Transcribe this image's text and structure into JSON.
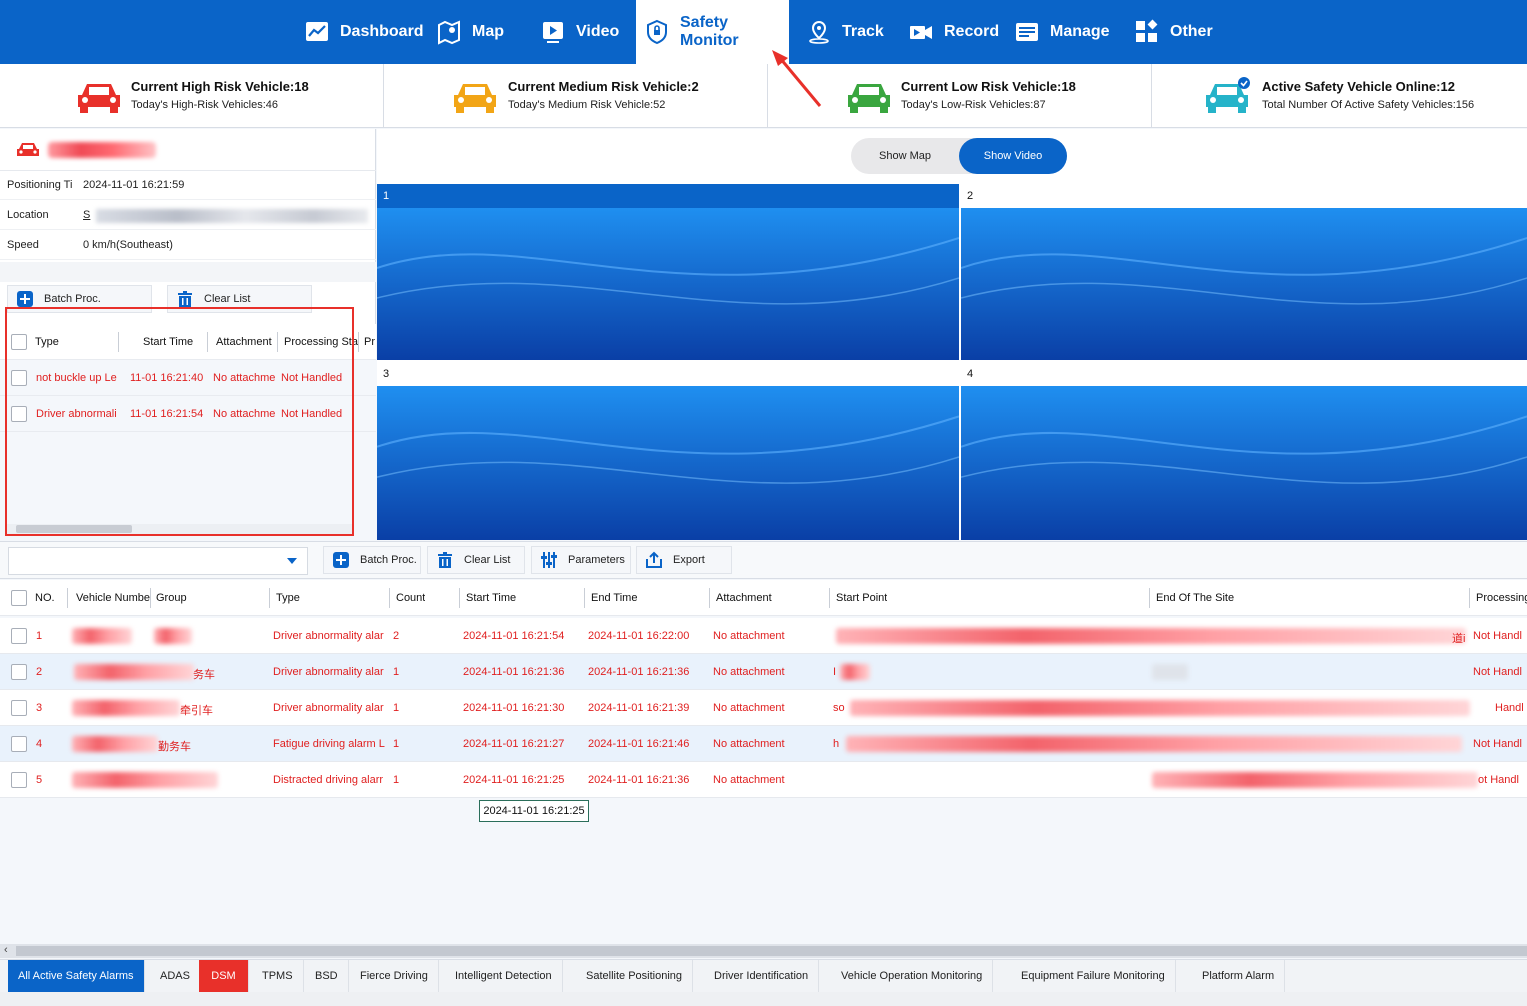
{
  "nav": {
    "items": [
      {
        "label": "Dashboard",
        "icon": "chart-icon"
      },
      {
        "label": "Map",
        "icon": "map-icon"
      },
      {
        "label": "Video",
        "icon": "video-icon"
      },
      {
        "label": "Safety Monitor",
        "icon": "shield-icon",
        "active": true
      },
      {
        "label": "Track",
        "icon": "location-icon"
      },
      {
        "label": "Record",
        "icon": "camera-icon"
      },
      {
        "label": "Manage",
        "icon": "manage-icon"
      },
      {
        "label": "Other",
        "icon": "grid-icon"
      }
    ]
  },
  "stats": [
    {
      "title": "Current High Risk Vehicle:18",
      "sub": "Today's High-Risk Vehicles:46",
      "color": "#e8302a"
    },
    {
      "title": "Current Medium Risk Vehicle:2",
      "sub": "Today's Medium Risk Vehicle:52",
      "color": "#f2a516"
    },
    {
      "title": "Current Low Risk Vehicle:18",
      "sub": "Today's Low-Risk Vehicles:87",
      "color": "#3aa63f"
    },
    {
      "title": "Active Safety Vehicle Online:12",
      "sub": "Total Number Of Active Safety Vehicles:156",
      "color": "#25b3c9"
    }
  ],
  "vehicle": {
    "positioning_label": "Positioning Ti",
    "positioning_value": "2024-11-01 16:21:59",
    "location_label": "Location",
    "location_prefix": "S",
    "speed_label": "Speed",
    "speed_value": "0 km/h(Southeast)"
  },
  "left_toolbar": {
    "batch": "Batch Proc.",
    "clear": "Clear List"
  },
  "left_table": {
    "headers": [
      "Type",
      "Start Time",
      "Attachment",
      "Processing Sta",
      "Pr"
    ],
    "rows": [
      {
        "type": "not buckle up Le",
        "start": "11-01 16:21:40",
        "attach": "No attachme",
        "status": "Not Handled"
      },
      {
        "type": "Driver abnormali",
        "start": "11-01 16:21:54",
        "attach": "No attachme",
        "status": "Not Handled"
      }
    ]
  },
  "video": {
    "show_map": "Show Map",
    "show_video": "Show Video",
    "tiles": [
      "1",
      "2",
      "3",
      "4"
    ]
  },
  "bottom_toolbar": {
    "batch": "Batch Proc.",
    "clear": "Clear List",
    "params": "Parameters",
    "export": "Export"
  },
  "bottom_table": {
    "headers": [
      "NO.",
      "Vehicle Numbe",
      "Group",
      "Type",
      "Count",
      "Start Time",
      "End Time",
      "Attachment",
      "Start Point",
      "End Of The Site",
      "Processing"
    ],
    "rows": [
      {
        "no": "1",
        "group_suffix": "",
        "type": "Driver abnormality alar",
        "count": "2",
        "start": "2024-11-01 16:21:54",
        "end": "2024-11-01 16:22:00",
        "attach": "No attachment",
        "start_prefix": "",
        "status": "Not Handl",
        "site_tail": "道i"
      },
      {
        "no": "2",
        "group_suffix": "务车",
        "type": "Driver abnormality alar",
        "count": "1",
        "start": "2024-11-01 16:21:36",
        "end": "2024-11-01 16:21:36",
        "attach": "No attachment",
        "start_prefix": "I",
        "status": "Not Handl",
        "site_tail": ""
      },
      {
        "no": "3",
        "group_suffix": "牵引车",
        "type": "Driver abnormality alar",
        "count": "1",
        "start": "2024-11-01 16:21:30",
        "end": "2024-11-01 16:21:39",
        "attach": "No attachment",
        "start_prefix": "so",
        "status": "Handl",
        "site_tail": ""
      },
      {
        "no": "4",
        "group_suffix": "勤务车",
        "type": "Fatigue driving alarm L",
        "count": "1",
        "start": "2024-11-01 16:21:27",
        "end": "2024-11-01 16:21:46",
        "attach": "No attachment",
        "start_prefix": "h",
        "status": "Not Handl",
        "site_tail": ""
      },
      {
        "no": "5",
        "group_suffix": "",
        "type": "Distracted driving alarr",
        "count": "1",
        "start": "2024-11-01 16:21:25",
        "end": "2024-11-01 16:21:36",
        "attach": "No attachment",
        "start_prefix": "",
        "status": "ot Handl",
        "site_tail": ""
      }
    ],
    "tooltip": "2024-11-01 16:21:25"
  },
  "tabs": [
    "All Active Safety Alarms",
    "ADAS",
    "DSM",
    "TPMS",
    "BSD",
    "Fierce Driving",
    "Intelligent Detection",
    "Satellite Positioning",
    "Driver Identification",
    "Vehicle Operation Monitoring",
    "Equipment Failure Monitoring",
    "Platform Alarm"
  ],
  "colors": {
    "primary": "#0a64c8",
    "alarm_text": "#e02020",
    "highlight_box": "#e8302a"
  }
}
